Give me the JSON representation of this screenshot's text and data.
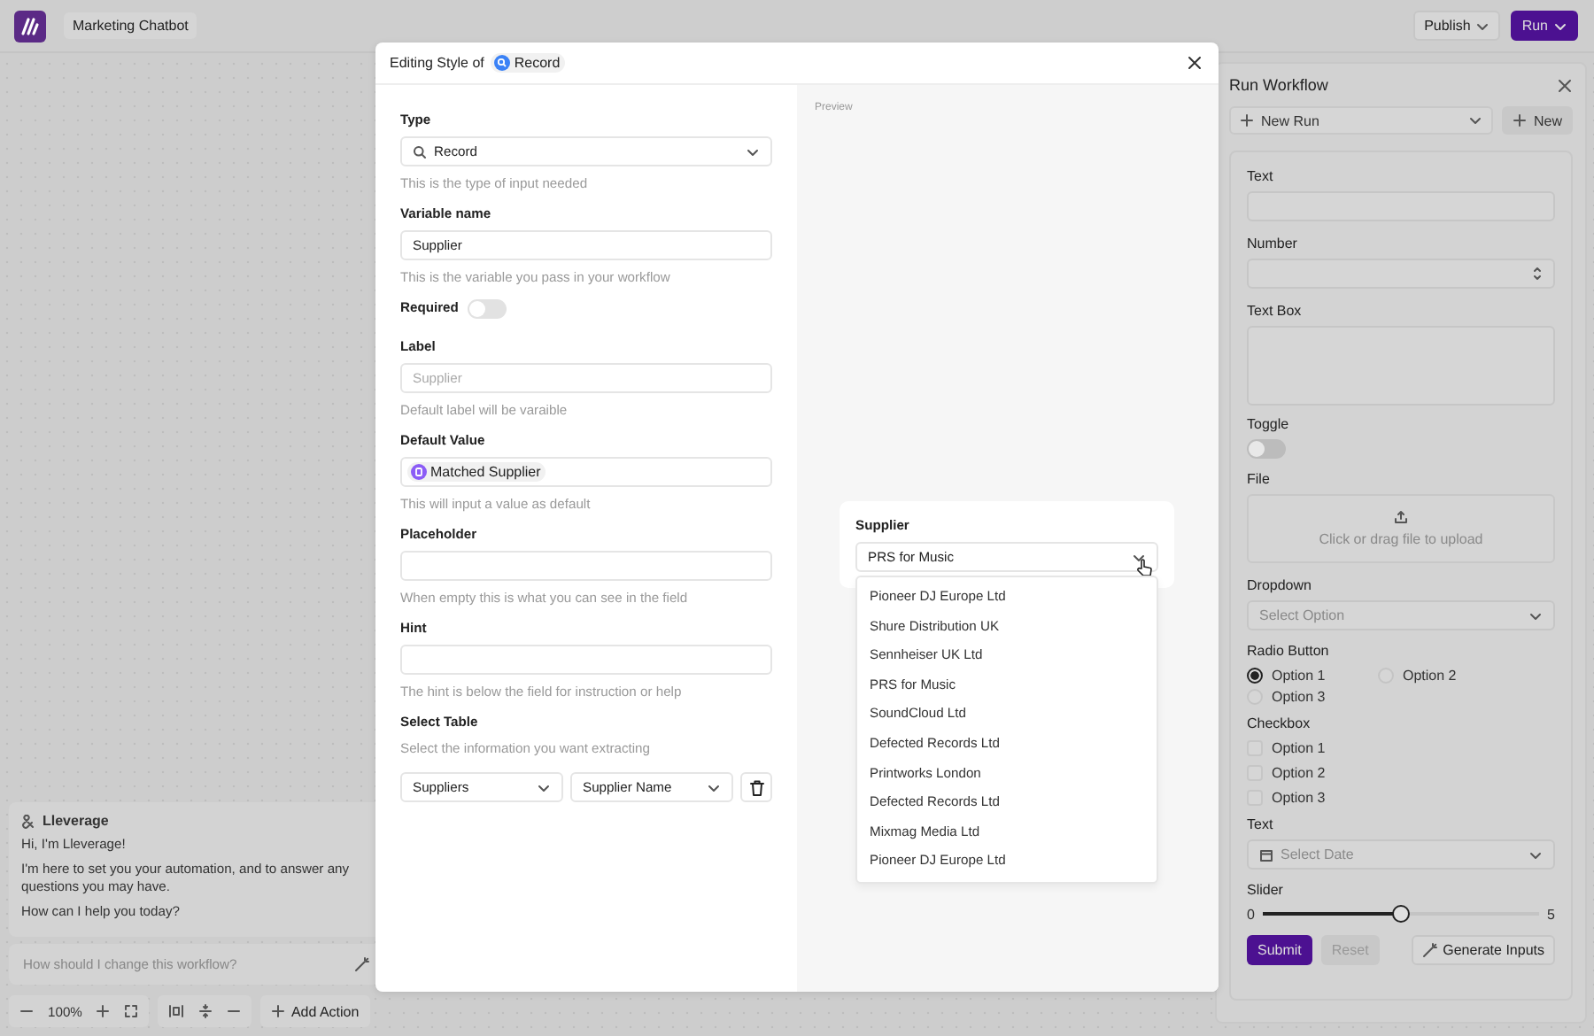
{
  "app": {
    "project": "Marketing Chatbot",
    "publish": "Publish",
    "run": "Run"
  },
  "chat": {
    "title": "Lleverage",
    "messages": [
      "Hi, I'm Lleverage!",
      "I'm here to set you your automation, and to answer any questions you may have.",
      "How can I help you today?"
    ],
    "placeholder": "How should I change this workflow?"
  },
  "toolbar": {
    "zoom": "100%",
    "add_action": "Add Action"
  },
  "run_panel": {
    "title": "Run Workflow",
    "run_select": "New Run",
    "new_button": "New",
    "fields": [
      {
        "kind": "text",
        "label": "Text"
      },
      {
        "kind": "number",
        "label": "Number"
      },
      {
        "kind": "textarea",
        "label": "Text Box"
      },
      {
        "kind": "toggle",
        "label": "Toggle",
        "on": false
      },
      {
        "kind": "file",
        "label": "File",
        "hint": "Click or drag file to upload"
      },
      {
        "kind": "dropdown",
        "label": "Dropdown",
        "placeholder": "Select Option"
      },
      {
        "kind": "radio",
        "label": "Radio Button",
        "options": [
          {
            "label": "Option 1",
            "selected": true
          },
          {
            "label": "Option 2",
            "selected": false
          },
          {
            "label": "Option 3",
            "selected": false
          }
        ]
      },
      {
        "kind": "checkbox",
        "label": "Checkbox",
        "options": [
          {
            "label": "Option 1",
            "checked": false
          },
          {
            "label": "Option 2",
            "checked": false
          },
          {
            "label": "Option 3",
            "checked": false
          }
        ]
      },
      {
        "kind": "date",
        "label": "Text",
        "placeholder": "Select Date"
      },
      {
        "kind": "slider",
        "label": "Slider",
        "min": "0",
        "max": "5",
        "level": 0.5
      }
    ],
    "submit": "Submit",
    "reset": {
      "label": "Reset",
      "disabled": true
    },
    "generate": "Generate Inputs"
  },
  "modal": {
    "title": "Editing Style of",
    "chip": "Record",
    "form": [
      {
        "kind": "select",
        "label": "Type",
        "value": "Record",
        "help": "This is the type of input needed"
      },
      {
        "kind": "input",
        "label": "Variable name",
        "value": "Supplier",
        "help": "This is the variable you pass in your workflow"
      },
      {
        "kind": "toggle",
        "label": "Required",
        "on": false
      },
      {
        "kind": "input",
        "label": "Label",
        "placeholder": "Supplier",
        "help": "Default label will be varaible"
      },
      {
        "kind": "chip",
        "label": "Default Value",
        "value": "Matched Supplier",
        "help": "This will input a value as default"
      },
      {
        "kind": "input",
        "label": "Placeholder",
        "help": "When empty this is what you can see in the field"
      },
      {
        "kind": "input",
        "label": "Hint",
        "help": "The hint is below the field for instruction or help"
      },
      {
        "kind": "table",
        "label": "Select Table",
        "help": "Select the information you want extracting",
        "selects": [
          "Suppliers",
          "Supplier Name"
        ]
      }
    ],
    "preview": {
      "label": "Preview",
      "field_label": "Supplier",
      "value": "PRS for Music",
      "options": [
        "Pioneer DJ Europe Ltd",
        "Shure Distribution UK",
        "Sennheiser UK Ltd",
        "PRS for Music",
        "SoundCloud Ltd",
        "Defected Records Ltd",
        "Printworks London",
        "Defected Records Ltd",
        "Mixmag Media Ltd",
        "Pioneer DJ Europe Ltd"
      ]
    }
  }
}
